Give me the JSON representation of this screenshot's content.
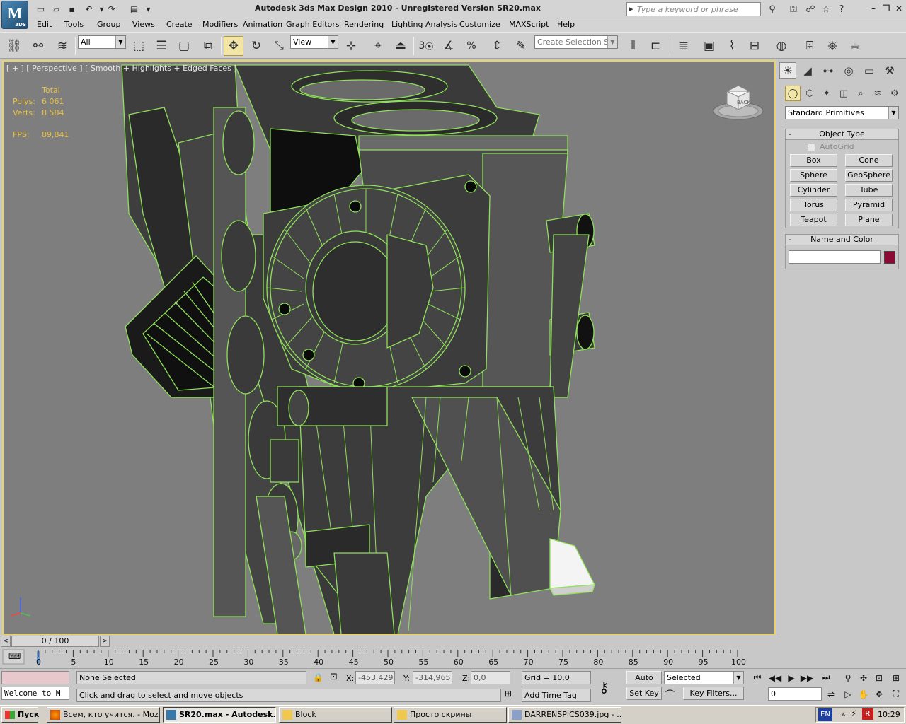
{
  "app": {
    "title": "Autodesk 3ds Max Design 2010  - Unregistered Version    SR20.max",
    "logo_text": "M",
    "logo_sub": "3DS",
    "search_placeholder": "Type a keyword or phrase"
  },
  "menu": [
    "Edit",
    "Tools",
    "Group",
    "Views",
    "Create",
    "Modifiers",
    "Animation",
    "Graph Editors",
    "Rendering",
    "Lighting Analysis",
    "Customize",
    "MAXScript",
    "Help"
  ],
  "toolbar": {
    "selection_filter": "All",
    "ref_coord": "View",
    "named_selection_placeholder": "Create Selection Se",
    "snap_label": "3"
  },
  "viewport": {
    "label": "[ + ] [ Perspective ] [ Smooth + Highlights + Edged Faces ]",
    "stats_header": "Total",
    "polys_label": "Polys:",
    "polys_value": "6 061",
    "verts_label": "Verts:",
    "verts_value": "8 584",
    "fps_label": "FPS:",
    "fps_value": "89,841",
    "viewcube_face": "BACK",
    "wire_color": "#8fe05a",
    "highlight_color": "#e8d36a"
  },
  "command_panel": {
    "category": "Standard Primitives",
    "object_type_title": "Object Type",
    "autogrid_label": "AutoGrid",
    "primitives": [
      "Box",
      "Cone",
      "Sphere",
      "GeoSphere",
      "Cylinder",
      "Tube",
      "Torus",
      "Pyramid",
      "Teapot",
      "Plane"
    ],
    "name_color_title": "Name and Color",
    "object_color": "#8a0a33"
  },
  "timeline": {
    "position": "0 / 100",
    "ticks": [
      "0",
      "5",
      "10",
      "15",
      "20",
      "25",
      "30",
      "35",
      "40",
      "45",
      "50",
      "55",
      "60",
      "65",
      "70",
      "75",
      "80",
      "85",
      "90",
      "95",
      "100"
    ]
  },
  "status": {
    "maxscript_listener": "Welcome to M",
    "selection": "None Selected",
    "prompt": "Click and drag to select and move objects",
    "x_label": "X:",
    "x_value": "-453,429",
    "y_label": "Y:",
    "y_value": "-314,965",
    "z_label": "Z:",
    "z_value": "0,0",
    "grid": "Grid = 10,0",
    "add_time_tag": "Add Time Tag",
    "auto_key": "Auto Key",
    "set_key": "Set Key",
    "key_mode": "Selected",
    "key_filters": "Key Filters...",
    "frame": "0"
  },
  "taskbar": {
    "start": "Пуск",
    "tasks": [
      "Всем, кто учится. - Moz...",
      "SR20.max - Autodesk...",
      "Block",
      "Просто скрины",
      "DARRENSPICS039.jpg - ..."
    ],
    "lang": "EN",
    "clock": "10:29"
  }
}
